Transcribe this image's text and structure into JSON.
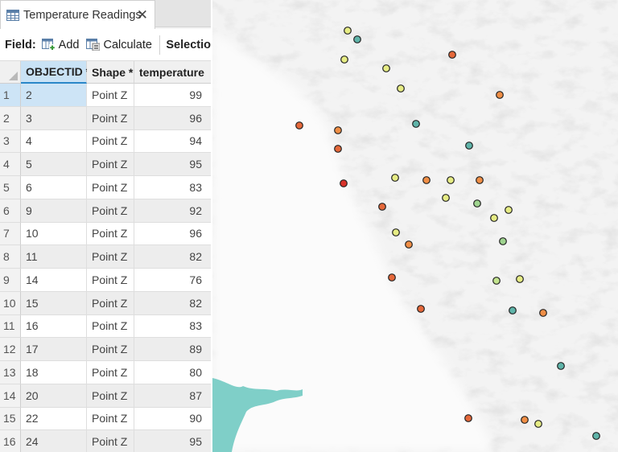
{
  "tab": {
    "title": "Temperature Readings",
    "icon": "table-icon",
    "close_glyph": "✕"
  },
  "toolbar": {
    "field_label": "Field:",
    "add_label": "Add",
    "calculate_label": "Calculate",
    "selection_label": "Selectio"
  },
  "table": {
    "columns": [
      "OBJECTID *",
      "Shape *",
      "temperature"
    ],
    "selected_row": 1,
    "rows": [
      {
        "n": "1",
        "objectid": "2",
        "shape": "Point Z",
        "temperature": "99"
      },
      {
        "n": "2",
        "objectid": "3",
        "shape": "Point Z",
        "temperature": "96"
      },
      {
        "n": "3",
        "objectid": "4",
        "shape": "Point Z",
        "temperature": "94"
      },
      {
        "n": "4",
        "objectid": "5",
        "shape": "Point Z",
        "temperature": "95"
      },
      {
        "n": "5",
        "objectid": "6",
        "shape": "Point Z",
        "temperature": "83"
      },
      {
        "n": "6",
        "objectid": "9",
        "shape": "Point Z",
        "temperature": "92"
      },
      {
        "n": "7",
        "objectid": "10",
        "shape": "Point Z",
        "temperature": "96"
      },
      {
        "n": "8",
        "objectid": "11",
        "shape": "Point Z",
        "temperature": "82"
      },
      {
        "n": "9",
        "objectid": "14",
        "shape": "Point Z",
        "temperature": "76"
      },
      {
        "n": "10",
        "objectid": "15",
        "shape": "Point Z",
        "temperature": "82"
      },
      {
        "n": "11",
        "objectid": "16",
        "shape": "Point Z",
        "temperature": "83"
      },
      {
        "n": "12",
        "objectid": "17",
        "shape": "Point Z",
        "temperature": "89"
      },
      {
        "n": "13",
        "objectid": "18",
        "shape": "Point Z",
        "temperature": "80"
      },
      {
        "n": "14",
        "objectid": "20",
        "shape": "Point Z",
        "temperature": "87"
      },
      {
        "n": "15",
        "objectid": "22",
        "shape": "Point Z",
        "temperature": "90"
      },
      {
        "n": "16",
        "objectid": "24",
        "shape": "Point Z",
        "temperature": "95"
      }
    ]
  },
  "map": {
    "basemap": "hillshade-terrain",
    "colors": {
      "land": "#f3f3f3",
      "valley": "#fbfbfb",
      "relief": "#c9c9c9",
      "water": "#7fcfc8",
      "point_outline": "#222222"
    },
    "point_classes": {
      "red": "#d8322a",
      "orange_red": "#e5683a",
      "orange": "#f08e45",
      "light_orange": "#f4ad58",
      "yellow": "#e6ec84",
      "light_green": "#c2e38e",
      "green": "#9fd48f",
      "teal": "#5fb4a9"
    }
  }
}
